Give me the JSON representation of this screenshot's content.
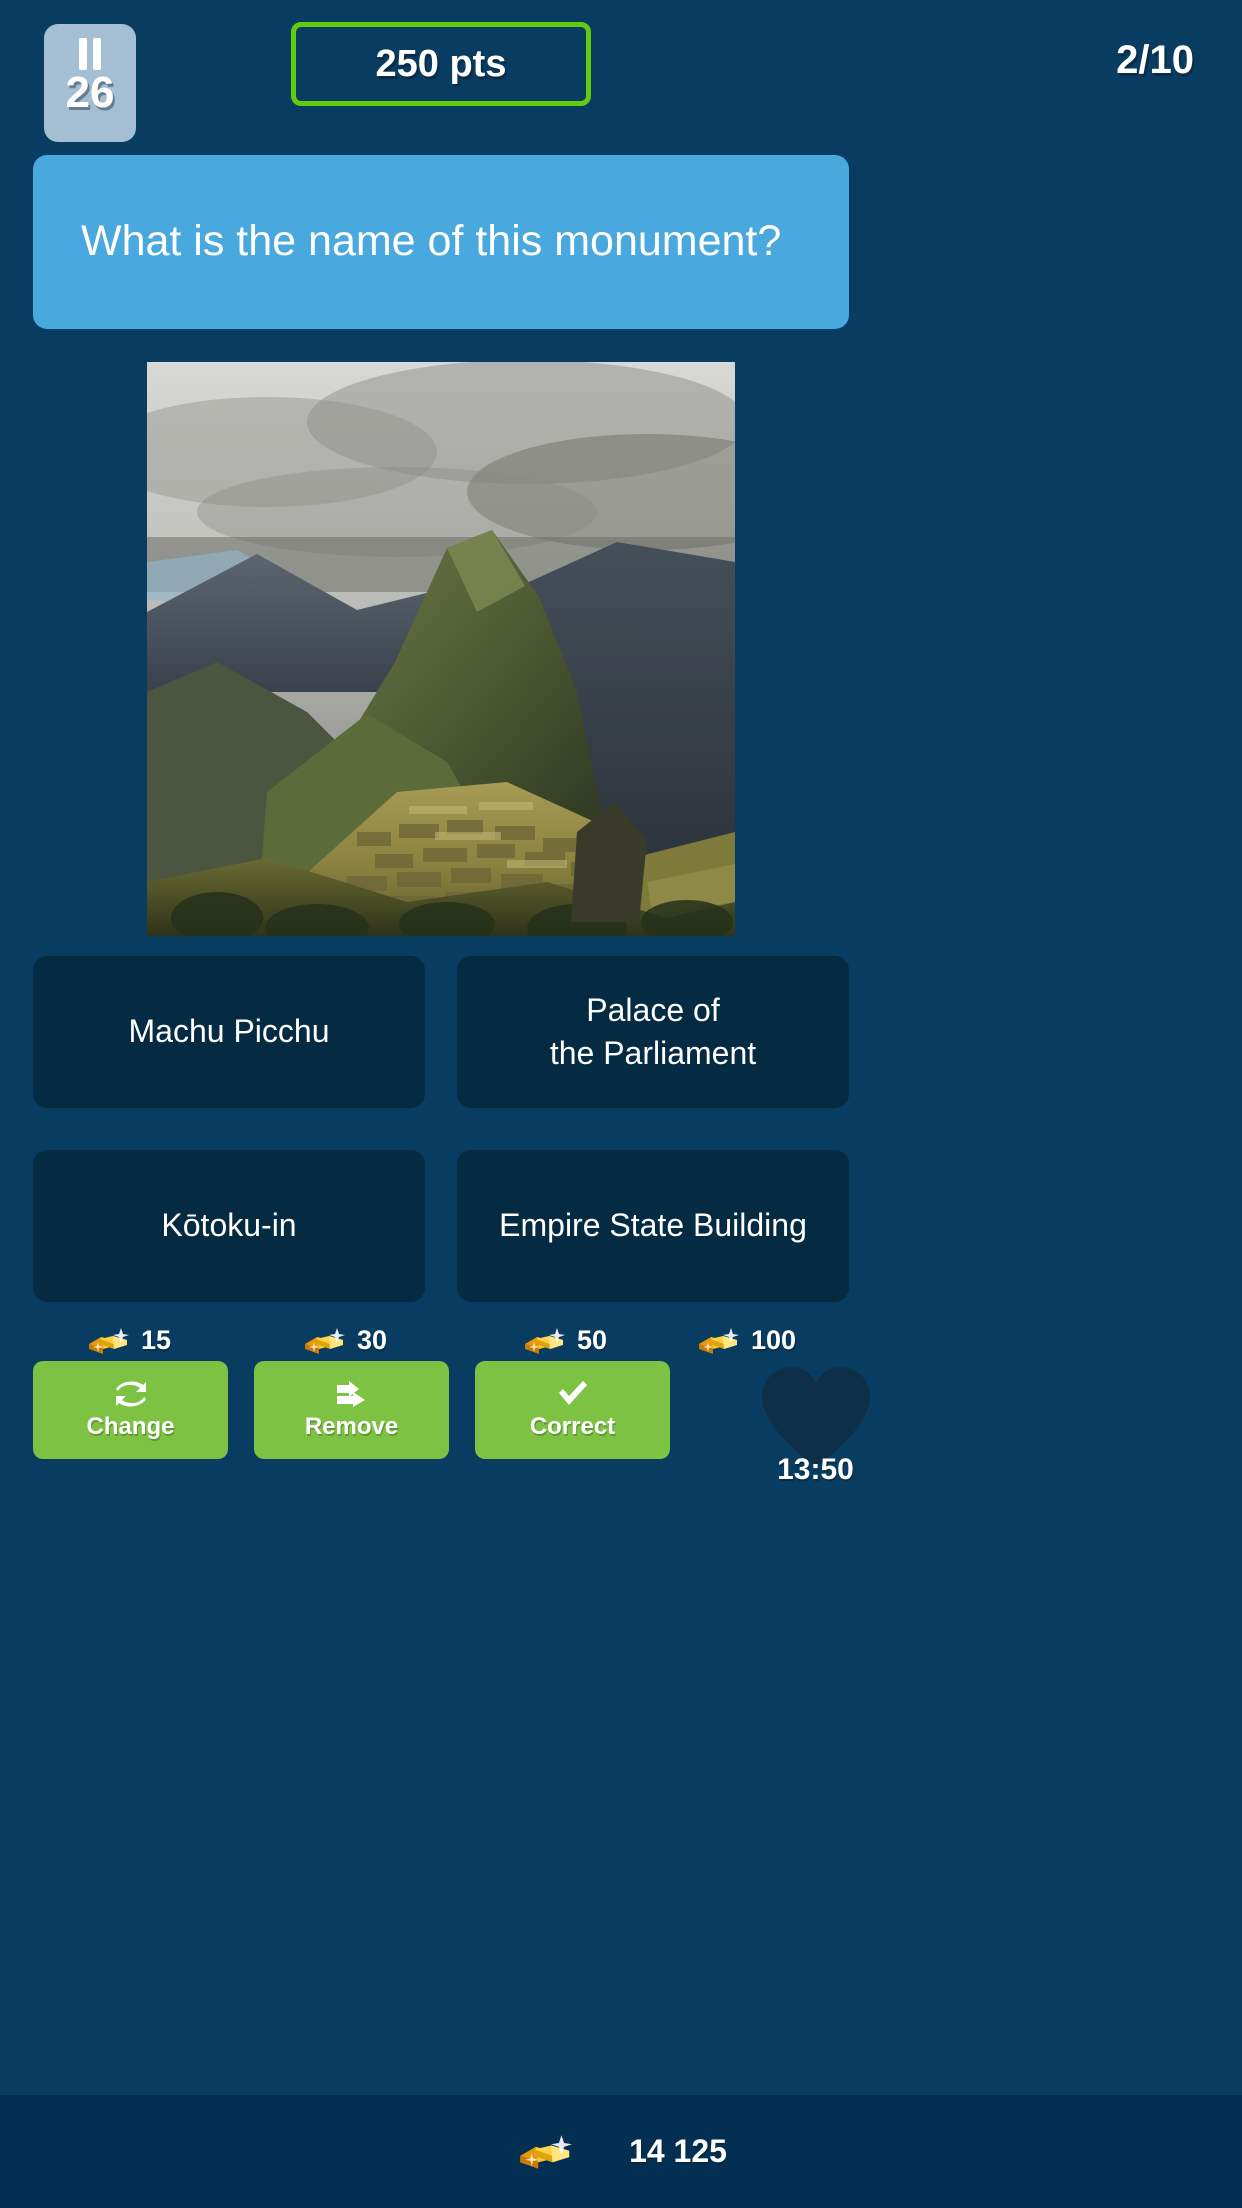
{
  "header": {
    "pause_icon": "pause-icon",
    "pause_count": "26",
    "points_label": "250 pts",
    "progress_label": "2/10",
    "accent_green": "#63cc0d"
  },
  "question": {
    "text": "What is the name of this monument?",
    "banner_color": "#49a8de",
    "image_alt": "machu-picchu-photo"
  },
  "answers": [
    {
      "label": "Machu Picchu"
    },
    {
      "label": "Palace of\nthe Parliament"
    },
    {
      "label": "Kōtoku-in"
    },
    {
      "label": "Empire State Building"
    }
  ],
  "powerups": [
    {
      "label": "Change",
      "cost": "15",
      "icon": "swap-icon"
    },
    {
      "label": "Remove",
      "cost": "30",
      "icon": "double-arrow-right-icon"
    },
    {
      "label": "Correct",
      "cost": "50",
      "icon": "checkmark-icon"
    }
  ],
  "life": {
    "cost": "100",
    "icon": "heart-icon",
    "timer": "13:50"
  },
  "bottom": {
    "currency_icon": "gold-bars-icon",
    "total": "14 125"
  },
  "colors": {
    "background": "#083d61",
    "answer_bg": "#042b42",
    "powerup_green": "#7dc242",
    "gold": "#f5b50a",
    "bottom_bar": "#033052"
  }
}
